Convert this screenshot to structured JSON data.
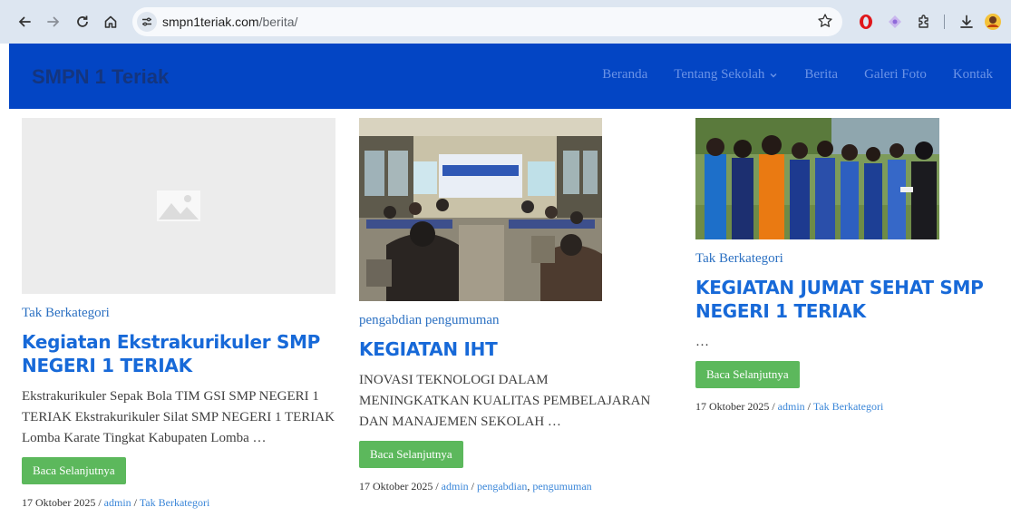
{
  "browser": {
    "url_host": "smpn1teriak.com",
    "url_path": "/berita/"
  },
  "site": {
    "title": "SMPN 1 Teriak",
    "nav": [
      {
        "label": "Beranda"
      },
      {
        "label": "Tentang Sekolah",
        "has_dropdown": true
      },
      {
        "label": "Berita"
      },
      {
        "label": "Galeri Foto"
      },
      {
        "label": "Kontak"
      }
    ]
  },
  "posts": [
    {
      "category": "Tak Berkategori",
      "title": "Kegiatan Ekstrakurikuler SMP NEGERI 1 TERIAK",
      "excerpt": "Ekstrakurikuler Sepak Bola TIM GSI SMP NEGERI 1 TERIAK Ekstrakurikuler Silat SMP NEGERI 1 TERIAK Lomba Karate Tingkat Kabupaten Lomba …",
      "button": "Baca Selanjutnya",
      "date": "17 Oktober 2025",
      "author": "admin",
      "categories": [
        "Tak Berkategori"
      ],
      "thumbnail": "placeholder-image-icon"
    },
    {
      "category": "pengabdian pengumuman",
      "title": "KEGIATAN IHT",
      "excerpt": "INOVASI TEKNOLOGI DALAM MENINGKATKAN KUALITAS PEMBELAJARAN DAN MANAJEMEN SEKOLAH …",
      "button": "Baca Selanjutnya",
      "date": "17 Oktober 2025",
      "author": "admin",
      "categories": [
        "pengabdian",
        "pengumuman"
      ],
      "thumbnail": "classroom-training-photo"
    },
    {
      "category": "Tak Berkategori",
      "title": "KEGIATAN JUMAT SEHAT SMP NEGERI 1 TERIAK",
      "excerpt": "…",
      "button": "Baca Selanjutnya",
      "date": "17 Oktober 2025",
      "author": "admin",
      "categories": [
        "Tak Berkategori"
      ],
      "thumbnail": "students-outdoor-photo"
    }
  ],
  "meta_separator": "/",
  "colors": {
    "header_bg": "#0345c4",
    "title_blue": "#1769d8",
    "button_green": "#5cb85c",
    "link_blue": "#3a86d8"
  }
}
